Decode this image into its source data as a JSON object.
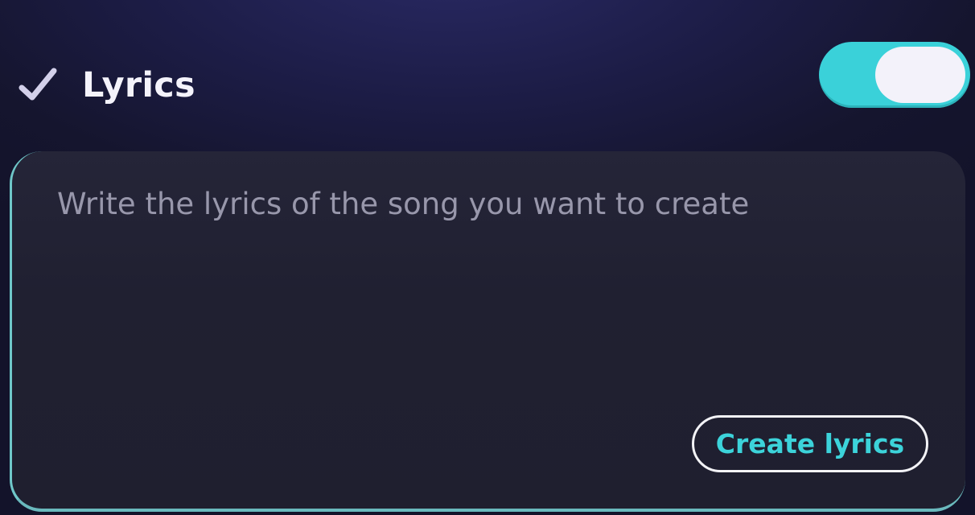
{
  "section": {
    "title": "Lyrics",
    "check_icon": "checkmark-icon",
    "toggle": {
      "state": "on",
      "color": "#3ad1d9"
    }
  },
  "editor": {
    "value": "",
    "placeholder": "Write the lyrics of the song you want to create",
    "create_button_label": "Create lyrics"
  },
  "colors": {
    "accent": "#3ad1d9",
    "title_text": "#f4f3fb",
    "placeholder_text": "#9897ab",
    "panel_background": "#202031"
  }
}
